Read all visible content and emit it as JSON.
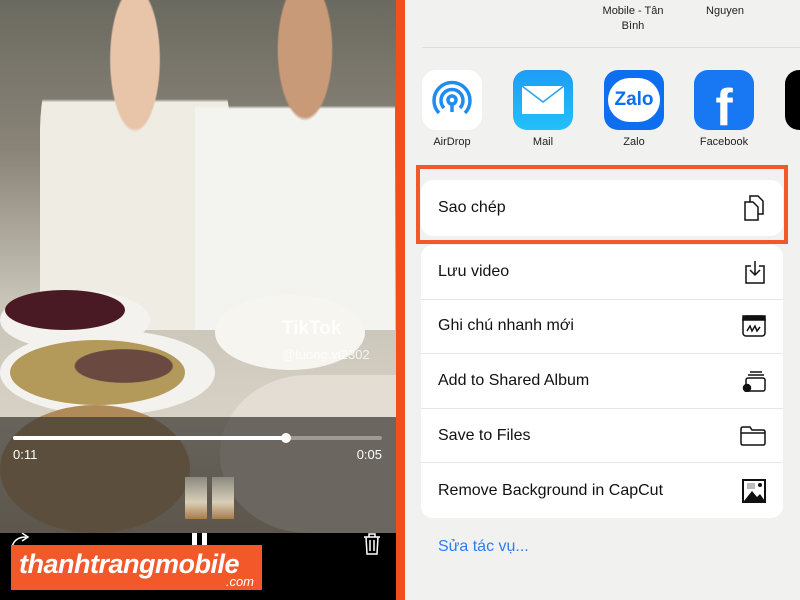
{
  "video": {
    "watermark": "TikTok",
    "username": "@tuong.vi2302",
    "elapsed": "0:11",
    "remaining": "0:05",
    "progress": 0.74
  },
  "logo": {
    "text": "thanhtrangmobile",
    ".com": ".com",
    "domain": ".com"
  },
  "share": {
    "contacts": [
      {
        "name": "Mobile - Tân\nBình"
      },
      {
        "name": "Nguyen"
      }
    ],
    "apps": [
      {
        "label": "AirDrop",
        "icon": "airdrop-icon"
      },
      {
        "label": "Mail",
        "icon": "mail-icon"
      },
      {
        "label": "Zalo",
        "icon": "zalo-icon"
      },
      {
        "label": "Facebook",
        "icon": "facebook-icon"
      }
    ],
    "copy": {
      "label": "Sao chép",
      "icon": "copy-icon"
    },
    "actions": [
      {
        "label": "Lưu video",
        "icon": "save-download-icon"
      },
      {
        "label": "Ghi chú nhanh mới",
        "icon": "quick-note-icon"
      },
      {
        "label": "Add to Shared Album",
        "icon": "shared-album-icon"
      },
      {
        "label": "Save to Files",
        "icon": "folder-icon"
      },
      {
        "label": "Remove Background in CapCut",
        "icon": "image-icon"
      }
    ],
    "edit_actions": "Sửa tác vụ...",
    "accent": "#2c7df0",
    "highlight": "#f2582a"
  }
}
